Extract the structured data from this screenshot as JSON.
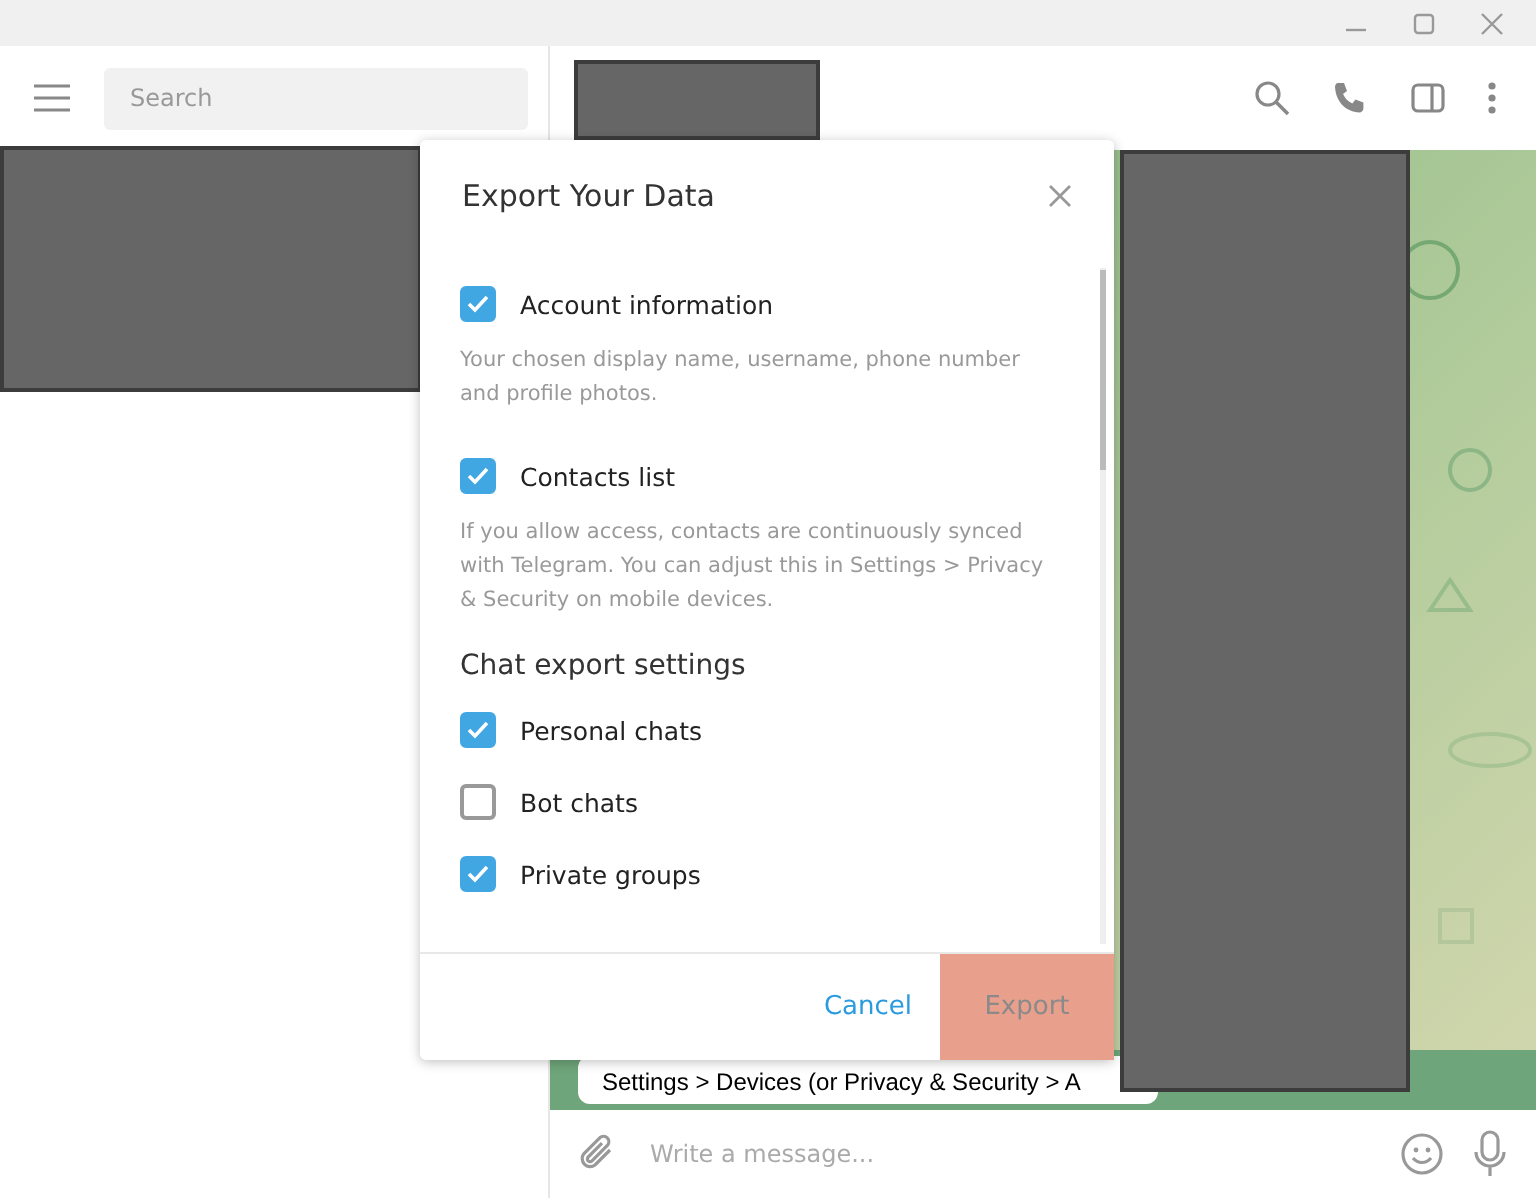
{
  "sidebar": {
    "search": {
      "placeholder": "Search"
    }
  },
  "chat": {
    "message": "Settings > Devices (or Privacy & Security > A",
    "composer": {
      "placeholder": "Write a message..."
    }
  },
  "dialog": {
    "title": "Export Your Data",
    "items": [
      {
        "kind": "option",
        "label": "Account information",
        "checked": true,
        "description": "Your chosen display name, username, phone number and profile photos."
      },
      {
        "kind": "option",
        "label": "Contacts list",
        "checked": true,
        "description": "If you allow access, contacts are continuously synced with Telegram. You can adjust this in Settings > Privacy & Security on mobile devices."
      },
      {
        "kind": "heading",
        "label": "Chat export settings"
      },
      {
        "kind": "option",
        "label": "Personal chats",
        "checked": true
      },
      {
        "kind": "option",
        "label": "Bot chats",
        "checked": false
      },
      {
        "kind": "option",
        "label": "Private groups",
        "checked": true
      }
    ],
    "buttons": [
      {
        "kind": "link",
        "label": "Cancel"
      },
      {
        "kind": "primary",
        "label": "Export"
      }
    ]
  }
}
